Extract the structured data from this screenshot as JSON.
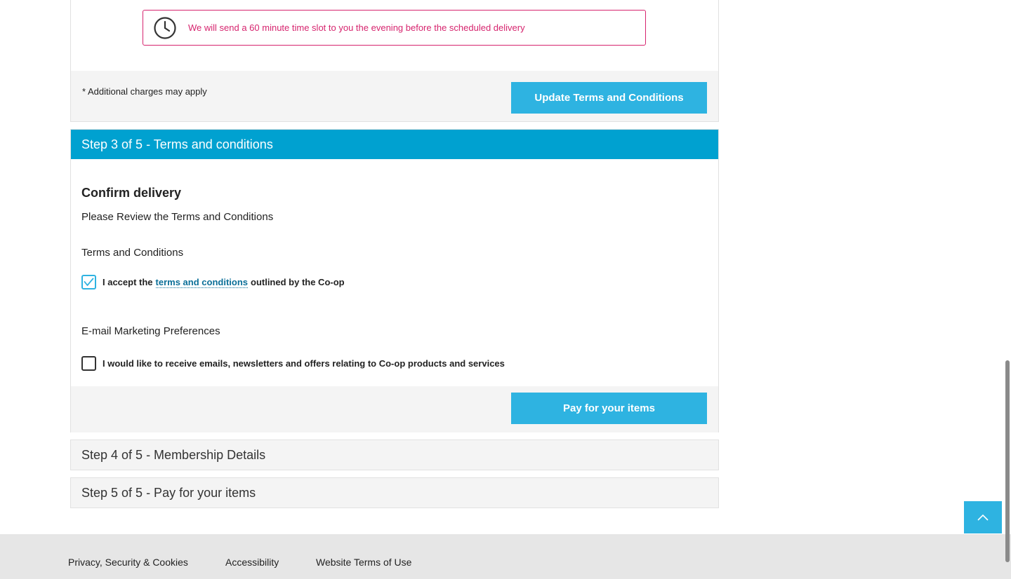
{
  "delivery_notice": {
    "icon": "clock-icon",
    "text": "We will send a 60 minute time slot to you the evening before the scheduled delivery",
    "color": "#d6246e"
  },
  "step2_footer": {
    "charges_note": "* Additional charges may apply",
    "update_button": "Update Terms and Conditions"
  },
  "step3": {
    "header": "Step 3 of 5 - Terms and conditions",
    "confirm_title": "Confirm delivery",
    "review_text": "Please Review the Terms and Conditions",
    "terms_label": "Terms and Conditions",
    "terms_checkbox": {
      "checked": true,
      "prefix": "I accept the",
      "link_text": "terms and conditions",
      "suffix": "outlined by the Co-op"
    },
    "email_label": "E-mail Marketing Preferences",
    "email_checkbox": {
      "checked": false,
      "text": "I would like to receive emails, newsletters and offers relating to Co-op products and services"
    },
    "pay_button": "Pay for your items"
  },
  "collapsed_steps": {
    "step4": "Step 4 of 5 - Membership Details",
    "step5": "Step 5 of 5 - Pay for your items"
  },
  "footer": {
    "links": [
      "Privacy, Security & Cookies",
      "Accessibility",
      "Website Terms of Use"
    ]
  },
  "colors": {
    "accent": "#2eb3e1",
    "header_blue": "#00a1d0",
    "link": "#0b6f98",
    "notice_pink": "#d6246e"
  }
}
